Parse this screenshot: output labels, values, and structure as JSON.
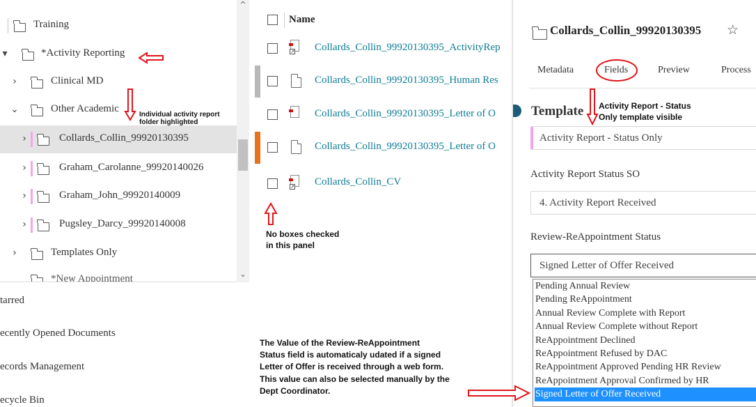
{
  "tree": {
    "items": [
      {
        "label": "Training"
      },
      {
        "label": "*Activity Reporting"
      },
      {
        "label": "Clinical MD"
      },
      {
        "label": "Other Academic"
      },
      {
        "label": "Collards_Collin_99920130395"
      },
      {
        "label": "Graham_Carolanne_99920140026"
      },
      {
        "label": "Graham_John_99920140009"
      },
      {
        "label": "Pugsley_Darcy_99920140008"
      },
      {
        "label": "Templates Only"
      }
    ],
    "partial_label": "*New Appointment"
  },
  "nav": {
    "starred": "tarred",
    "recent": "ecently Opened Documents",
    "records": "ecords Management",
    "recycle": "ecycle Bin"
  },
  "file_list": {
    "header": "Name",
    "files": [
      {
        "name": "Collards_Collin_99920130395_ActivityRep",
        "icon": "pdf-shortcut-icon"
      },
      {
        "name": "Collards_Collin_99920130395_Human Res",
        "icon": "document-icon"
      },
      {
        "name": "Collards_Collin_99920130395_Letter of O",
        "icon": "pdf-icon"
      },
      {
        "name": "Collards_Collin_99920130395_Letter of O",
        "icon": "document-icon"
      },
      {
        "name": "Collards_Collin_CV",
        "icon": "pdf-shortcut-icon"
      }
    ]
  },
  "detail": {
    "title": "Collards_Collin_99920130395",
    "star_icon": "star-outline-icon",
    "tabs": [
      "Metadata",
      "Fields",
      "Preview",
      "Process"
    ],
    "active_tab": "Fields",
    "template_heading": "Template",
    "template_value": "Activity Report - Status Only",
    "status_label": "Activity Report Status SO",
    "status_value": "4. Activity Report Received",
    "review_label": "Review-ReAppointment Status",
    "review_value": "Signed Letter of Offer Received",
    "review_options": [
      "Pending Annual Review",
      "Pending ReAppointment",
      "Annual Review Complete with Report",
      "Annual Review Complete without Report",
      "ReAppointment Declined",
      "ReAppointment Refused by DAC",
      "ReAppointment Approved Pending HR Review",
      "ReAppointment Approval Confirmed by HR",
      "Signed Letter of Offer Received"
    ]
  },
  "annotations": {
    "folder_note": [
      "Individual activity report",
      "folder highlighted"
    ],
    "template_note": [
      "Activity Report - Status",
      "Only template visible"
    ],
    "checkbox_note": [
      "No boxes checked",
      "in this panel"
    ],
    "value_note": [
      "The Value of the Review-ReAppointment",
      "Status field is automaticaly udated if a signed",
      "Letter of Offer is received through a web form.",
      "This value can also be selected manually by the",
      "Dept Coordinator."
    ]
  },
  "colors": {
    "link": "#0e7c95",
    "accent_pink": "#f2a6e8",
    "annotation_red": "#e0151b",
    "selected_option": "#1e90ff",
    "row_marker_gray": "#b8b8b8",
    "row_marker_orange": "#e8711b"
  }
}
